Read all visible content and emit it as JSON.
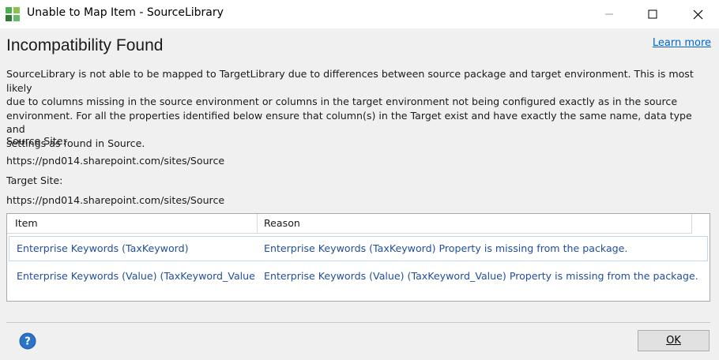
{
  "window": {
    "title": "Unable to Map Item - SourceLibrary"
  },
  "dialog": {
    "heading": "Incompatibility Found",
    "learn_more": "Learn more",
    "description_lines": [
      "SourceLibrary is not able to be mapped to TargetLibrary due to differences between source package and target environment.  This is most likely",
      "due to columns missing in the source environment or columns in the target environment not being configured exactly as in the source",
      "environment.  For all the properties identified below ensure that column(s) in the Target exist and have exactly the same name, data type and",
      "settings as found in Source."
    ],
    "source_site_label": "Source Site:",
    "source_site_url": "https://pnd014.sharepoint.com/sites/Source",
    "target_site_label": "Target Site:",
    "target_site_url": "https://pnd014.sharepoint.com/sites/Source"
  },
  "grid": {
    "columns": [
      "Item",
      "Reason"
    ],
    "rows": [
      {
        "item": "Enterprise Keywords (TaxKeyword)",
        "reason": "Enterprise Keywords (TaxKeyword) Property is missing from the package."
      },
      {
        "item": "Enterprise Keywords (Value) (TaxKeyword_Value",
        "reason": "Enterprise Keywords (Value) (TaxKeyword_Value) Property is missing from the package."
      }
    ]
  },
  "footer": {
    "ok_label": "OK"
  },
  "colors": {
    "link": "#0066cc",
    "cell_text": "#1f4e9e",
    "help_icon": "#2b73c9",
    "app_icon_green": "#5cb85c"
  }
}
